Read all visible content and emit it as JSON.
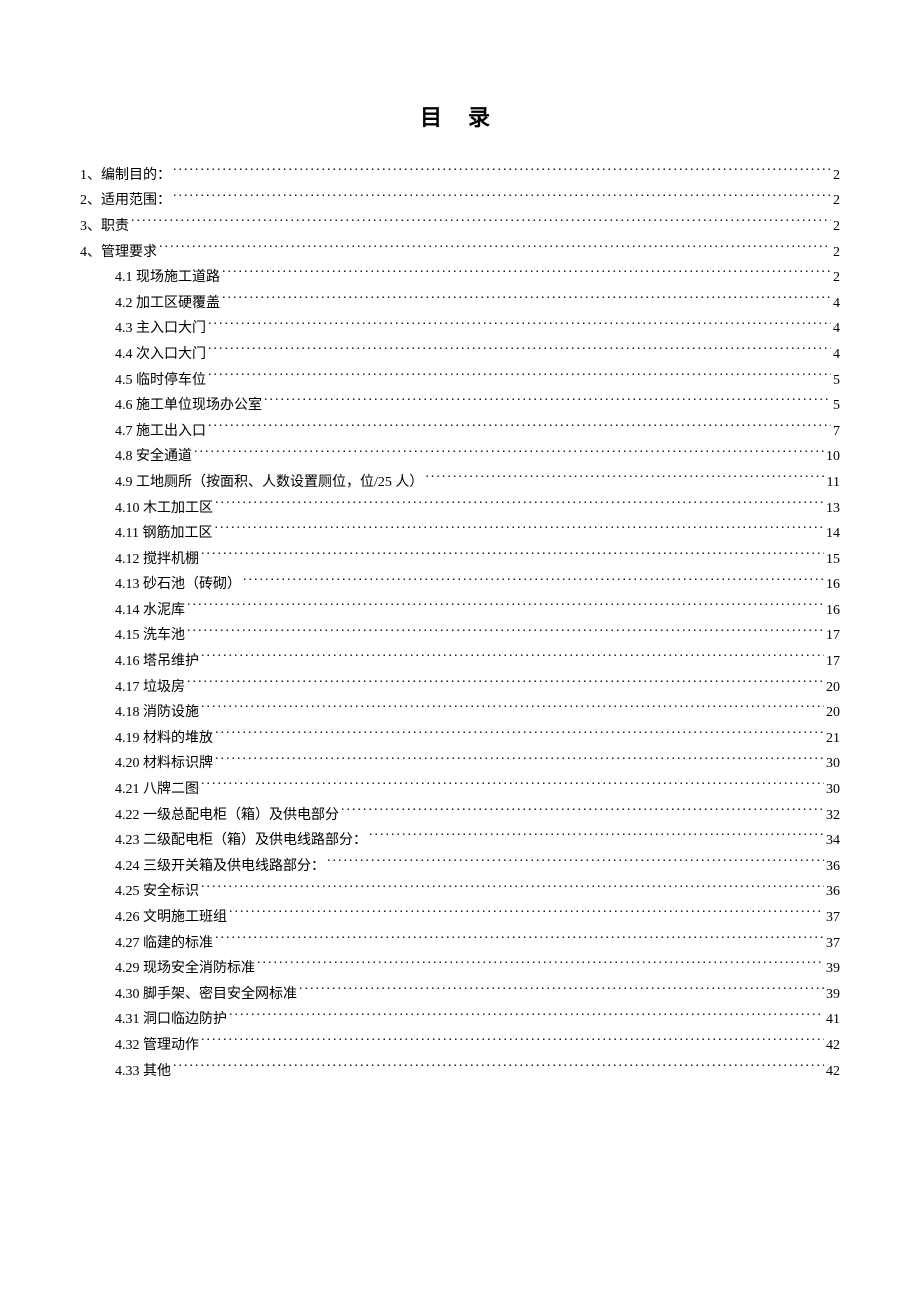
{
  "title": "目 录",
  "toc": [
    {
      "level": 0,
      "label": "1、编制目的：",
      "page": "2"
    },
    {
      "level": 0,
      "label": "2、适用范围：",
      "page": "2"
    },
    {
      "level": 0,
      "label": "3、职责",
      "page": "2"
    },
    {
      "level": 0,
      "label": "4、管理要求",
      "page": "2"
    },
    {
      "level": 1,
      "label": "4.1 现场施工道路",
      "page": "2"
    },
    {
      "level": 1,
      "label": "4.2 加工区硬覆盖",
      "page": "4"
    },
    {
      "level": 1,
      "label": "4.3 主入口大门",
      "page": "4"
    },
    {
      "level": 1,
      "label": "4.4 次入口大门",
      "page": "4"
    },
    {
      "level": 1,
      "label": "4.5 临时停车位",
      "page": "5"
    },
    {
      "level": 1,
      "label": "4.6 施工单位现场办公室",
      "page": "5"
    },
    {
      "level": 1,
      "label": "4.7 施工出入口",
      "page": "7"
    },
    {
      "level": 1,
      "label": "4.8 安全通道",
      "page": "10"
    },
    {
      "level": 1,
      "label": "4.9 工地厕所（按面积、人数设置厕位，位/25 人）",
      "page": "11"
    },
    {
      "level": 1,
      "label": "4.10 木工加工区",
      "page": "13"
    },
    {
      "level": 1,
      "label": "4.11 钢筋加工区",
      "page": "14"
    },
    {
      "level": 1,
      "label": "4.12 搅拌机棚",
      "page": "15"
    },
    {
      "level": 1,
      "label": "4.13 砂石池（砖砌）",
      "page": "16"
    },
    {
      "level": 1,
      "label": "4.14 水泥库",
      "page": "16"
    },
    {
      "level": 1,
      "label": "4.15 洗车池",
      "page": "17"
    },
    {
      "level": 1,
      "label": "4.16 塔吊维护",
      "page": "17"
    },
    {
      "level": 1,
      "label": "4.17 垃圾房",
      "page": "20"
    },
    {
      "level": 1,
      "label": "4.18 消防设施",
      "page": "20"
    },
    {
      "level": 1,
      "label": "4.19  材料的堆放",
      "page": "21"
    },
    {
      "level": 1,
      "label": "4.20 材料标识牌",
      "page": "30"
    },
    {
      "level": 1,
      "label": "4.21 八牌二图",
      "page": "30"
    },
    {
      "level": 1,
      "label": "4.22 一级总配电柜（箱）及供电部分",
      "page": "32"
    },
    {
      "level": 1,
      "label": "4.23 二级配电柜（箱）及供电线路部分：",
      "page": "34"
    },
    {
      "level": 1,
      "label": "4.24 三级开关箱及供电线路部分：",
      "page": "36"
    },
    {
      "level": 1,
      "label": "4.25 安全标识",
      "page": "36"
    },
    {
      "level": 1,
      "label": "4.26 文明施工班组",
      "page": "37"
    },
    {
      "level": 1,
      "label": "4.27 临建的标准",
      "page": "37"
    },
    {
      "level": 1,
      "label": "4.29 现场安全消防标准",
      "page": "39"
    },
    {
      "level": 1,
      "label": "4.30 脚手架、密目安全网标准",
      "page": "39"
    },
    {
      "level": 1,
      "label": "4.31  洞口临边防护",
      "page": "41"
    },
    {
      "level": 1,
      "label": "4.32  管理动作",
      "page": "42"
    },
    {
      "level": 1,
      "label": "4.33 其他",
      "page": "42"
    }
  ]
}
